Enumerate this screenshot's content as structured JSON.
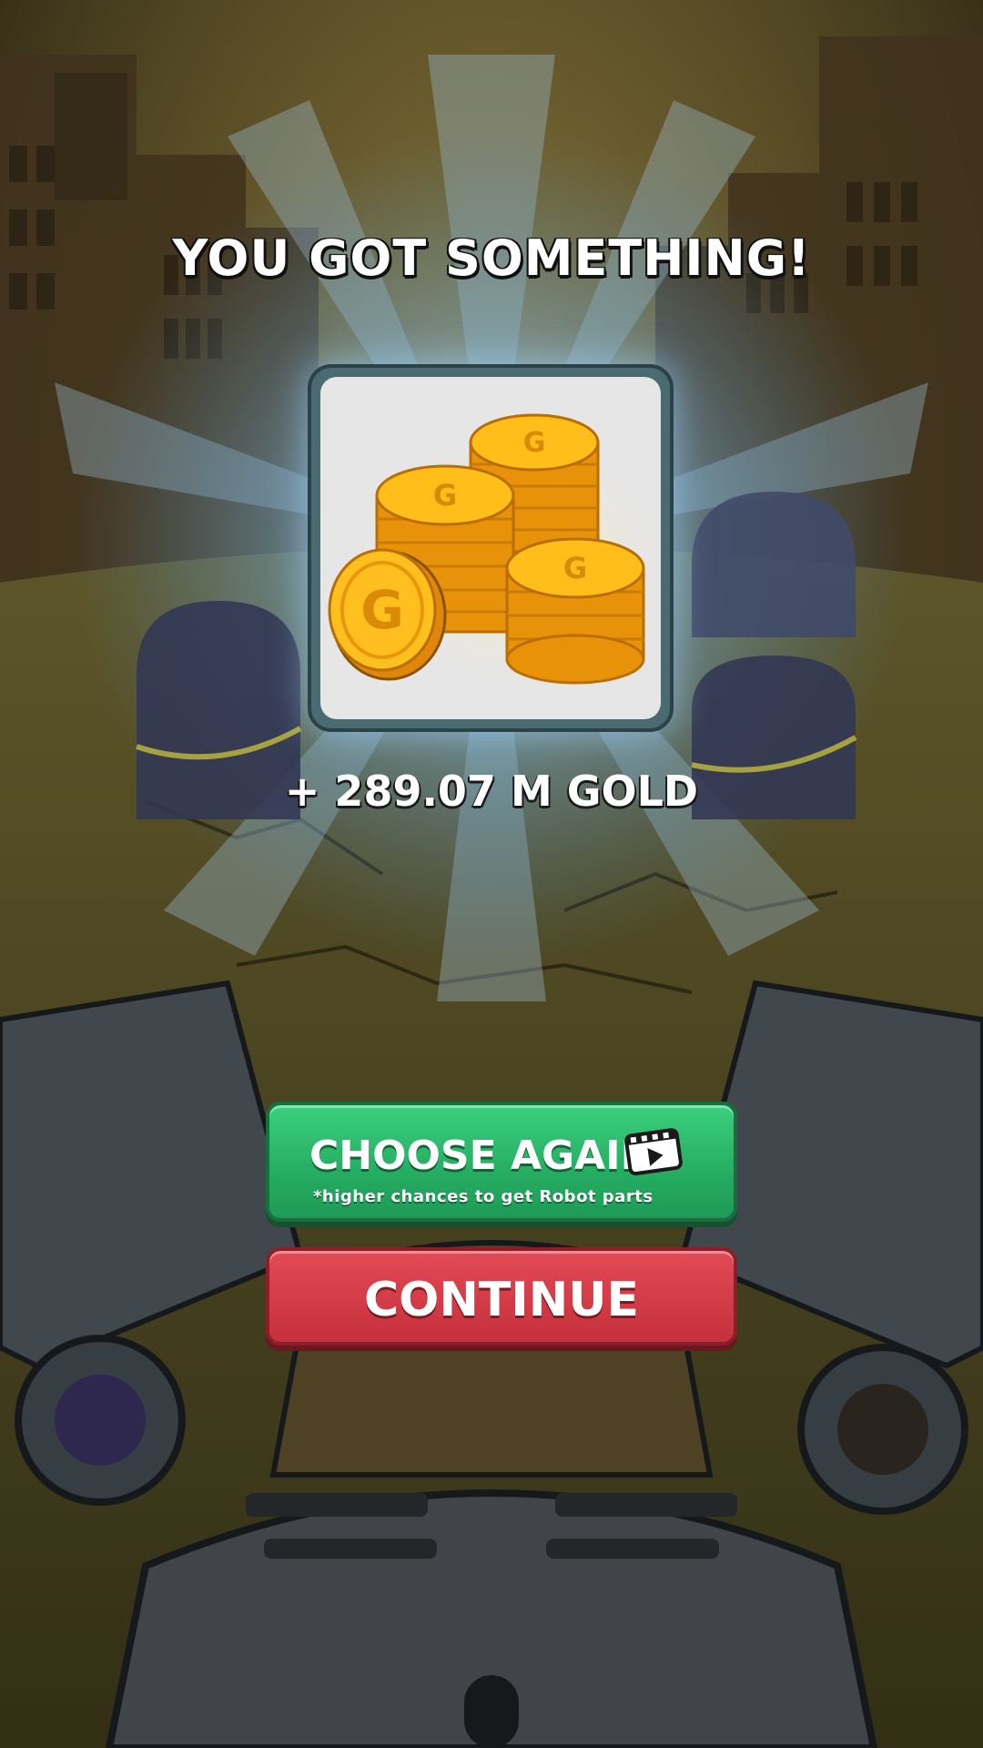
{
  "screen": {
    "title": "YOU GOT SOMETHING!",
    "reward": {
      "icon": "gold-coins-icon",
      "amount_text": "+ 289.07 M GOLD"
    }
  },
  "buttons": {
    "choose_again": {
      "label": "CHOOSE AGAIN",
      "sub_label": "*higher chances to get Robot parts",
      "icon": "video-ad-icon",
      "color": "#25ad62"
    },
    "continue": {
      "label": "CONTINUE",
      "color": "#d23a45"
    }
  }
}
